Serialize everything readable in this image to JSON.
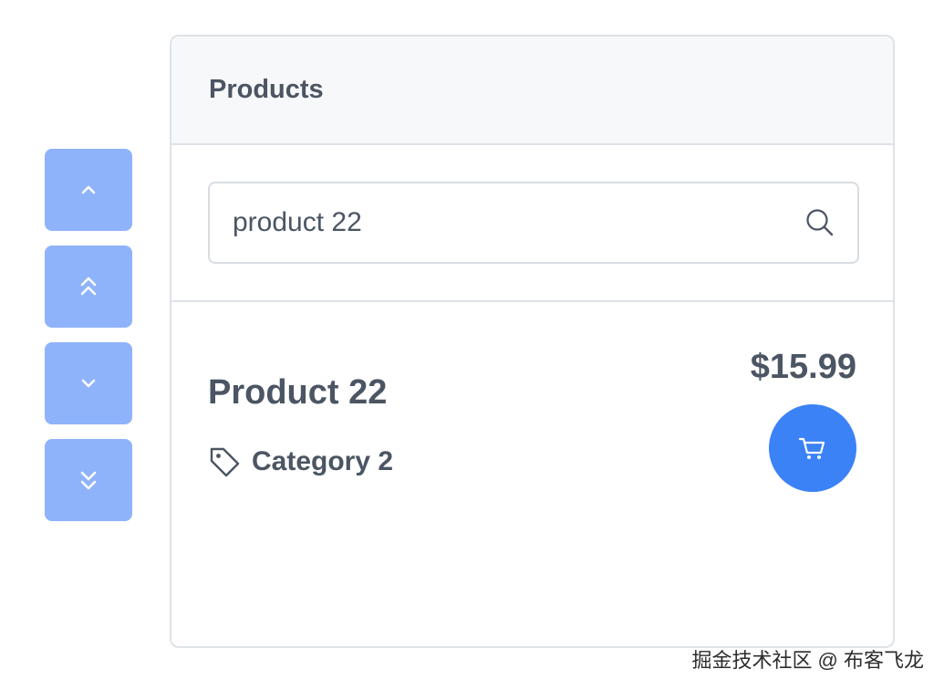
{
  "controls": [
    {
      "name": "scroll-up-button",
      "icon": "chevron-up-icon"
    },
    {
      "name": "scroll-to-top-button",
      "icon": "double-chevron-up-icon"
    },
    {
      "name": "scroll-down-button",
      "icon": "chevron-down-icon"
    },
    {
      "name": "scroll-to-bottom-button",
      "icon": "double-chevron-down-icon"
    }
  ],
  "panel": {
    "title": "Products"
  },
  "search": {
    "value": "product 22",
    "icon": "search-icon"
  },
  "product": {
    "name": "Product 22",
    "category": "Category 2",
    "price": "$15.99",
    "cart_icon": "cart-icon"
  },
  "colors": {
    "control_button": "#8fb3fb",
    "cart_button": "#3b82f6",
    "text": "#4b5563",
    "border": "#dfe3e8",
    "header_bg": "#f7f8fa"
  },
  "watermark": "掘金技术社区 @ 布客飞龙"
}
